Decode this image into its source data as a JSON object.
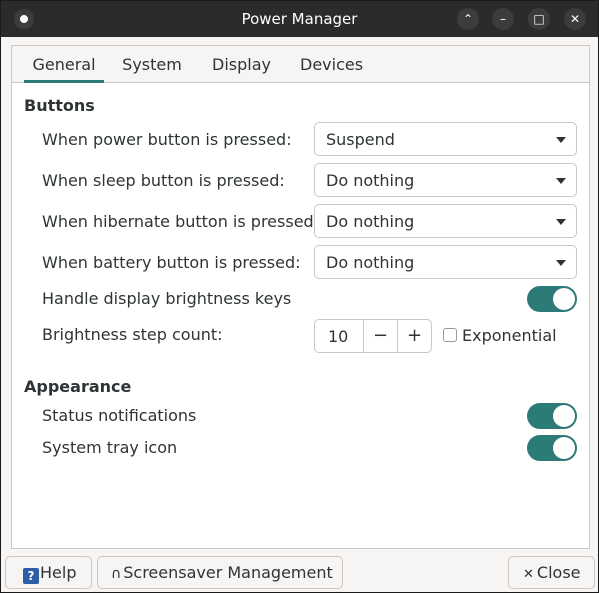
{
  "window": {
    "title": "Power Manager",
    "controls": {
      "restore": "⌃",
      "minimize": "–",
      "maximize": "□",
      "close": "✕"
    }
  },
  "tabs": [
    "General",
    "System",
    "Display",
    "Devices"
  ],
  "active_tab": "General",
  "sections": {
    "buttons": {
      "title": "Buttons",
      "power": {
        "label": "When power button is pressed:",
        "value": "Suspend"
      },
      "sleep": {
        "label": "When sleep button is pressed:",
        "value": "Do nothing"
      },
      "hibernate": {
        "label": "When hibernate button is pressed:",
        "value": "Do nothing"
      },
      "battery": {
        "label": "When battery button is pressed:",
        "value": "Do nothing"
      },
      "brightness_keys": {
        "label": "Handle display brightness keys",
        "enabled": true
      },
      "step_count": {
        "label": "Brightness step count:",
        "value": "10",
        "minus": "−",
        "plus": "+"
      },
      "exponential": {
        "label": "Exponential",
        "checked": false
      }
    },
    "appearance": {
      "title": "Appearance",
      "status_notifications": {
        "label": "Status notifications",
        "enabled": true
      },
      "tray_icon": {
        "label": "System tray icon",
        "enabled": true
      }
    }
  },
  "footer": {
    "help": {
      "icon": "?",
      "label": "Help"
    },
    "screensaver": {
      "icon": "∩",
      "label": "Screensaver Management"
    },
    "close": {
      "icon": "✕",
      "label": "Close"
    }
  },
  "colors": {
    "accent": "#2d7b76",
    "titlebar": "#2b2b2b"
  }
}
